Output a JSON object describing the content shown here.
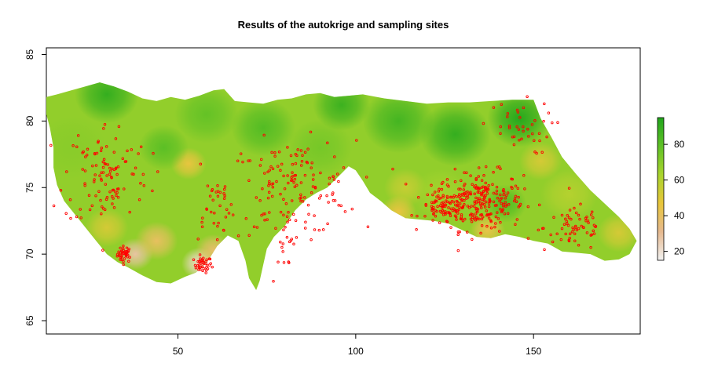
{
  "chart_data": {
    "type": "heatmap",
    "title": "Results of the autokrige and sampling sites",
    "xlabel": "",
    "ylabel": "",
    "xlim": [
      13,
      180
    ],
    "ylim": [
      64,
      85.5
    ],
    "x_ticks": [
      50,
      100,
      150
    ],
    "y_ticks": [
      65,
      70,
      75,
      80,
      85
    ],
    "colorbar": {
      "range": [
        15,
        95
      ],
      "ticks": [
        20,
        40,
        60,
        80
      ],
      "colors": [
        "#f2f2f2",
        "#e6b98f",
        "#e8c63a",
        "#a9d42d",
        "#5fc126",
        "#21a51c"
      ]
    },
    "region_outline": [
      [
        13,
        81.8
      ],
      [
        16,
        82.0
      ],
      [
        20,
        82.3
      ],
      [
        24,
        82.6
      ],
      [
        28,
        82.9
      ],
      [
        32,
        82.6
      ],
      [
        36,
        82.2
      ],
      [
        40,
        81.7
      ],
      [
        44,
        81.5
      ],
      [
        48,
        81.8
      ],
      [
        52,
        81.6
      ],
      [
        56,
        81.9
      ],
      [
        60,
        82.3
      ],
      [
        63,
        82.4
      ],
      [
        66,
        81.5
      ],
      [
        70,
        81.4
      ],
      [
        74,
        81.3
      ],
      [
        78,
        81.6
      ],
      [
        82,
        81.7
      ],
      [
        86,
        82.0
      ],
      [
        90,
        82.1
      ],
      [
        94,
        81.8
      ],
      [
        98,
        81.9
      ],
      [
        102,
        82.0
      ],
      [
        108,
        81.7
      ],
      [
        114,
        81.5
      ],
      [
        120,
        81.3
      ],
      [
        126,
        81.4
      ],
      [
        132,
        81.4
      ],
      [
        138,
        81.5
      ],
      [
        144,
        81.6
      ],
      [
        150,
        81.6
      ],
      [
        152,
        80.2
      ],
      [
        155,
        78.8
      ],
      [
        158,
        77.3
      ],
      [
        162,
        76.0
      ],
      [
        166,
        74.8
      ],
      [
        170,
        73.8
      ],
      [
        174,
        72.8
      ],
      [
        177,
        71.9
      ],
      [
        179,
        71.0
      ],
      [
        177,
        70.0
      ],
      [
        174,
        69.6
      ],
      [
        170,
        69.5
      ],
      [
        166,
        70.0
      ],
      [
        162,
        70.1
      ],
      [
        158,
        70.2
      ],
      [
        154,
        70.8
      ],
      [
        150,
        71.0
      ],
      [
        146,
        71.3
      ],
      [
        142,
        71.5
      ],
      [
        138,
        71.2
      ],
      [
        134,
        71.3
      ],
      [
        130,
        71.8
      ],
      [
        126,
        72.3
      ],
      [
        122,
        72.5
      ],
      [
        118,
        72.6
      ],
      [
        114,
        72.7
      ],
      [
        110,
        73.3
      ],
      [
        107,
        74.0
      ],
      [
        104,
        74.6
      ],
      [
        102,
        75.5
      ],
      [
        100,
        76.3
      ],
      [
        98,
        76.6
      ],
      [
        95,
        75.8
      ],
      [
        92,
        75.0
      ],
      [
        89,
        74.6
      ],
      [
        86,
        74.1
      ],
      [
        83,
        73.3
      ],
      [
        80,
        72.1
      ],
      [
        77,
        71.3
      ],
      [
        75,
        70.4
      ],
      [
        74,
        69.2
      ],
      [
        73,
        68.0
      ],
      [
        72,
        67.3
      ],
      [
        70,
        68.2
      ],
      [
        69,
        69.5
      ],
      [
        67,
        71.0
      ],
      [
        64,
        71.4
      ],
      [
        61,
        70.6
      ],
      [
        58,
        69.3
      ],
      [
        55,
        68.6
      ],
      [
        52,
        68.3
      ],
      [
        48,
        67.8
      ],
      [
        44,
        67.9
      ],
      [
        40,
        68.4
      ],
      [
        36,
        69.0
      ],
      [
        33,
        69.4
      ],
      [
        30,
        70.0
      ],
      [
        27,
        71.0
      ],
      [
        24,
        72.0
      ],
      [
        21,
        73.0
      ],
      [
        18,
        74.0
      ],
      [
        16,
        75.2
      ],
      [
        15,
        76.5
      ],
      [
        15,
        78.0
      ],
      [
        14,
        79.5
      ],
      [
        13,
        80.5
      ]
    ],
    "value_centers": [
      {
        "x": 30,
        "y": 82,
        "value": 90,
        "r": 9
      },
      {
        "x": 20,
        "y": 78,
        "value": 70,
        "r": 10
      },
      {
        "x": 30,
        "y": 72,
        "value": 52,
        "r": 6
      },
      {
        "x": 38,
        "y": 70,
        "value": 28,
        "r": 5
      },
      {
        "x": 44,
        "y": 71,
        "value": 40,
        "r": 6
      },
      {
        "x": 56,
        "y": 69.3,
        "value": 22,
        "r": 5
      },
      {
        "x": 60,
        "y": 70.3,
        "value": 38,
        "r": 5
      },
      {
        "x": 53,
        "y": 76.8,
        "value": 46,
        "r": 5
      },
      {
        "x": 46,
        "y": 78,
        "value": 80,
        "r": 7
      },
      {
        "x": 58,
        "y": 80.5,
        "value": 78,
        "r": 9
      },
      {
        "x": 74,
        "y": 79.5,
        "value": 82,
        "r": 9
      },
      {
        "x": 90,
        "y": 78,
        "value": 74,
        "r": 9
      },
      {
        "x": 96,
        "y": 81.2,
        "value": 88,
        "r": 8
      },
      {
        "x": 112,
        "y": 80,
        "value": 86,
        "r": 10
      },
      {
        "x": 128,
        "y": 79,
        "value": 90,
        "r": 10
      },
      {
        "x": 146,
        "y": 80.2,
        "value": 94,
        "r": 9
      },
      {
        "x": 114,
        "y": 75,
        "value": 56,
        "r": 6
      },
      {
        "x": 112,
        "y": 73.2,
        "value": 46,
        "r": 5
      },
      {
        "x": 124,
        "y": 74.5,
        "value": 64,
        "r": 8
      },
      {
        "x": 137,
        "y": 71.8,
        "value": 44,
        "r": 5
      },
      {
        "x": 142,
        "y": 73.8,
        "value": 82,
        "r": 6
      },
      {
        "x": 152,
        "y": 77,
        "value": 52,
        "r": 6
      },
      {
        "x": 160,
        "y": 74.5,
        "value": 60,
        "r": 8
      },
      {
        "x": 174,
        "y": 71.6,
        "value": 52,
        "r": 6
      }
    ],
    "sampling_site_clusters": [
      {
        "x": 35,
        "y": 70.0,
        "spread_x": 2.0,
        "spread_y": 0.6,
        "count": 40
      },
      {
        "x": 57,
        "y": 69.2,
        "spread_x": 2.5,
        "spread_y": 0.6,
        "count": 40
      },
      {
        "x": 135,
        "y": 74.0,
        "spread_x": 12.0,
        "spread_y": 2.2,
        "count": 240
      },
      {
        "x": 162,
        "y": 72.0,
        "spread_x": 9.0,
        "spread_y": 1.8,
        "count": 60
      },
      {
        "x": 125,
        "y": 73.5,
        "spread_x": 7.0,
        "spread_y": 1.3,
        "count": 80
      },
      {
        "x": 82,
        "y": 75.0,
        "spread_x": 18.0,
        "spread_y": 3.5,
        "count": 150
      },
      {
        "x": 30,
        "y": 76.0,
        "spread_x": 12.0,
        "spread_y": 4.0,
        "count": 110
      },
      {
        "x": 60,
        "y": 73.5,
        "spread_x": 6.0,
        "spread_y": 2.5,
        "count": 30
      },
      {
        "x": 145,
        "y": 79.5,
        "spread_x": 10.0,
        "spread_y": 2.0,
        "count": 40
      },
      {
        "x": 80,
        "y": 70.5,
        "spread_x": 3.0,
        "spread_y": 1.5,
        "count": 15
      }
    ],
    "point_color": "#ff0000"
  }
}
